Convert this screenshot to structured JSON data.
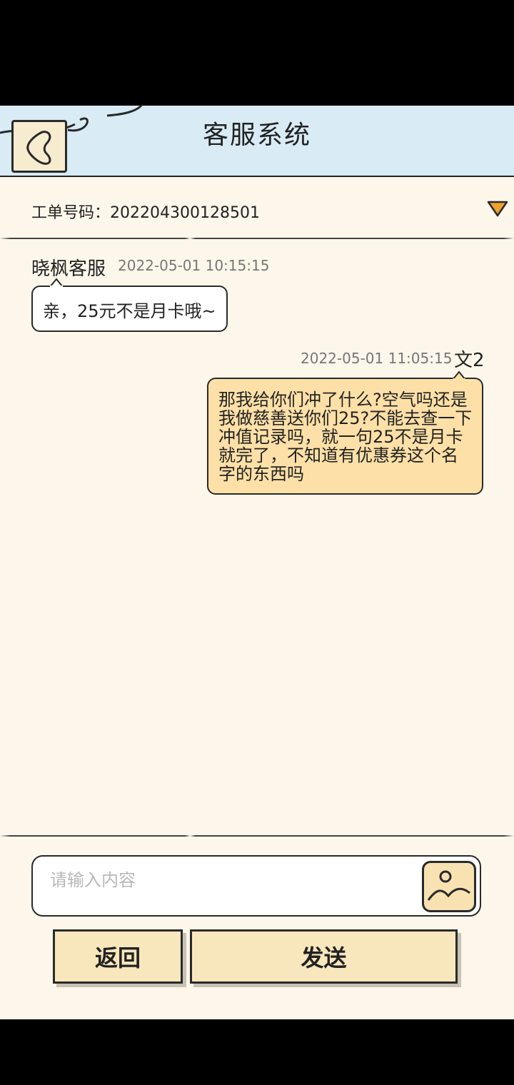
{
  "header": {
    "title": "客服系统",
    "back_icon": "back-icon"
  },
  "ticket": {
    "label": "工单号码：202204300128501",
    "toggle_icon": "triangle-down-icon",
    "toggle_color": "#f0a22e"
  },
  "messages": [
    {
      "sender": "晓枫客服",
      "time": "2022-05-01 10:15:15",
      "text": "亲，25元不是月卡哦~",
      "side": "left"
    },
    {
      "sender": "文2",
      "time": "2022-05-01 11:05:15",
      "text": "那我给你们冲了什么?空气吗还是我做慈善送你们25?不能去查一下冲值记录吗，就一句25不是月卡就完了，不知道有优惠券这个名字的东西吗",
      "side": "right"
    }
  ],
  "composer": {
    "placeholder": "请输入内容",
    "value": "",
    "image_icon": "image-icon"
  },
  "buttons": {
    "back_label": "返回",
    "send_label": "发送"
  },
  "colors": {
    "header_bg": "#d9ebf5",
    "page_bg": "#fdf6ea",
    "user_bubble": "#fde0a7",
    "button_bg": "#f8e6bd"
  }
}
